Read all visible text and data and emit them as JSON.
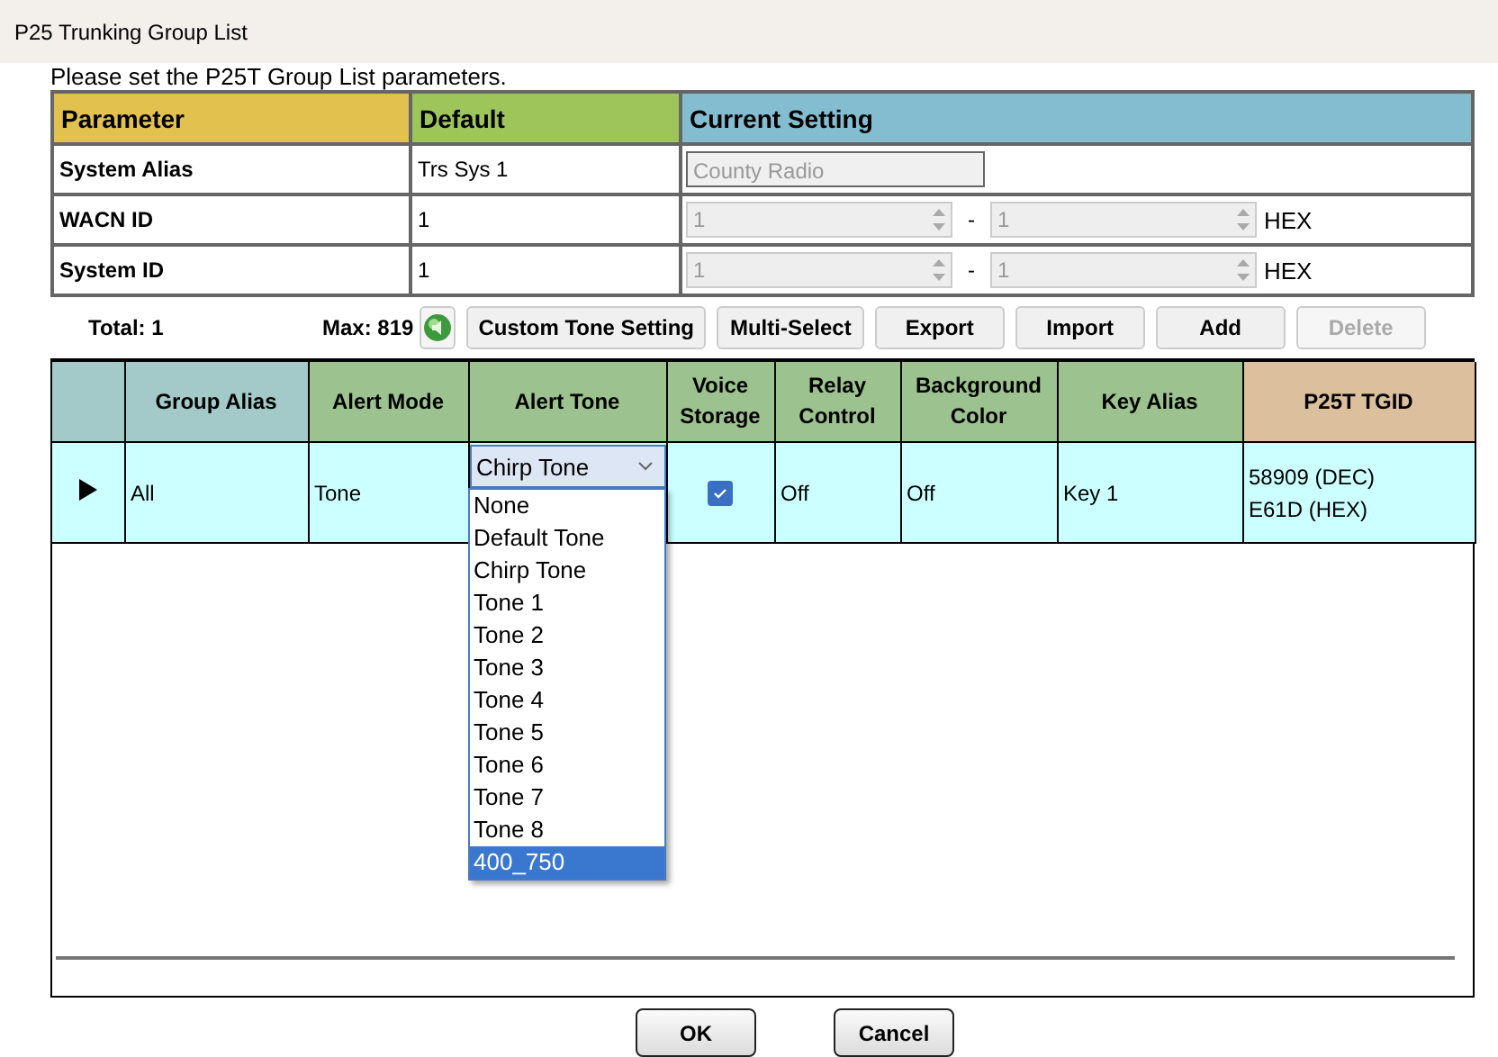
{
  "window": {
    "title": "P25 Trunking Group List"
  },
  "instruction": "Please set the P25T Group List parameters.",
  "parameters": {
    "columns": [
      {
        "label": "Parameter",
        "color": "#e2c14e"
      },
      {
        "label": "Default",
        "color": "#9dc55a"
      },
      {
        "label": "Current Setting",
        "color": "#84bdd0"
      }
    ],
    "rows": [
      {
        "kind": "text",
        "name": "System Alias",
        "default": "Trs Sys 1",
        "value": "County Radio",
        "disabled": true
      },
      {
        "kind": "range",
        "name": "WACN ID",
        "default": "1",
        "from": "1",
        "to": "1",
        "separator": "-",
        "unit": "HEX",
        "disabled": true
      },
      {
        "kind": "range",
        "name": "System ID",
        "default": "1",
        "from": "1",
        "to": "1",
        "separator": "-",
        "unit": "HEX",
        "disabled": true
      }
    ]
  },
  "toolbar": {
    "total": "Total: 1",
    "max": "Max: 819",
    "buttons": [
      {
        "label": "Custom Tone Setting",
        "disabled": false
      },
      {
        "label": "Multi-Select",
        "disabled": false
      },
      {
        "label": "Export",
        "disabled": false
      },
      {
        "label": "Import",
        "disabled": false
      },
      {
        "label": "Add",
        "disabled": false
      },
      {
        "label": "Delete",
        "disabled": true
      }
    ]
  },
  "grid": {
    "columns": [
      {
        "color": "#a3c9c9"
      },
      {
        "label": "Group Alias",
        "color": "#a3c9c9"
      },
      {
        "label": "Alert Mode",
        "color": "#9cc28f"
      },
      {
        "label": "Alert Tone",
        "color": "#9cc28f"
      },
      {
        "label": "Voice Storage",
        "color": "#9cc28f"
      },
      {
        "label": "Relay Control",
        "color": "#9cc28f"
      },
      {
        "label": "Background Color",
        "color": "#9cc28f"
      },
      {
        "label": "Key Alias",
        "color": "#9cc28f"
      },
      {
        "label": "P25T TGID",
        "color": "#dcbf9d"
      }
    ],
    "rows": [
      {
        "current": true,
        "group_alias": "All",
        "alert_mode": "Tone",
        "alert_tone": "Chirp Tone",
        "voice_storage": true,
        "relay_control": "Off",
        "background_color": "Off",
        "key_alias": "Key 1",
        "tgid": [
          "58909 (DEC)",
          "E61D (HEX)"
        ]
      }
    ]
  },
  "dropdown": {
    "options": [
      {
        "label": "None",
        "selected": false
      },
      {
        "label": "Default Tone",
        "selected": false
      },
      {
        "label": "Chirp Tone",
        "selected": false
      },
      {
        "label": "Tone 1",
        "selected": false
      },
      {
        "label": "Tone 2",
        "selected": false
      },
      {
        "label": "Tone 3",
        "selected": false
      },
      {
        "label": "Tone 4",
        "selected": false
      },
      {
        "label": "Tone 5",
        "selected": false
      },
      {
        "label": "Tone 6",
        "selected": false
      },
      {
        "label": "Tone 7",
        "selected": false
      },
      {
        "label": "Tone 8",
        "selected": false
      },
      {
        "label": "400_750",
        "selected": true
      }
    ]
  },
  "buttons": [
    "OK",
    "Cancel"
  ]
}
